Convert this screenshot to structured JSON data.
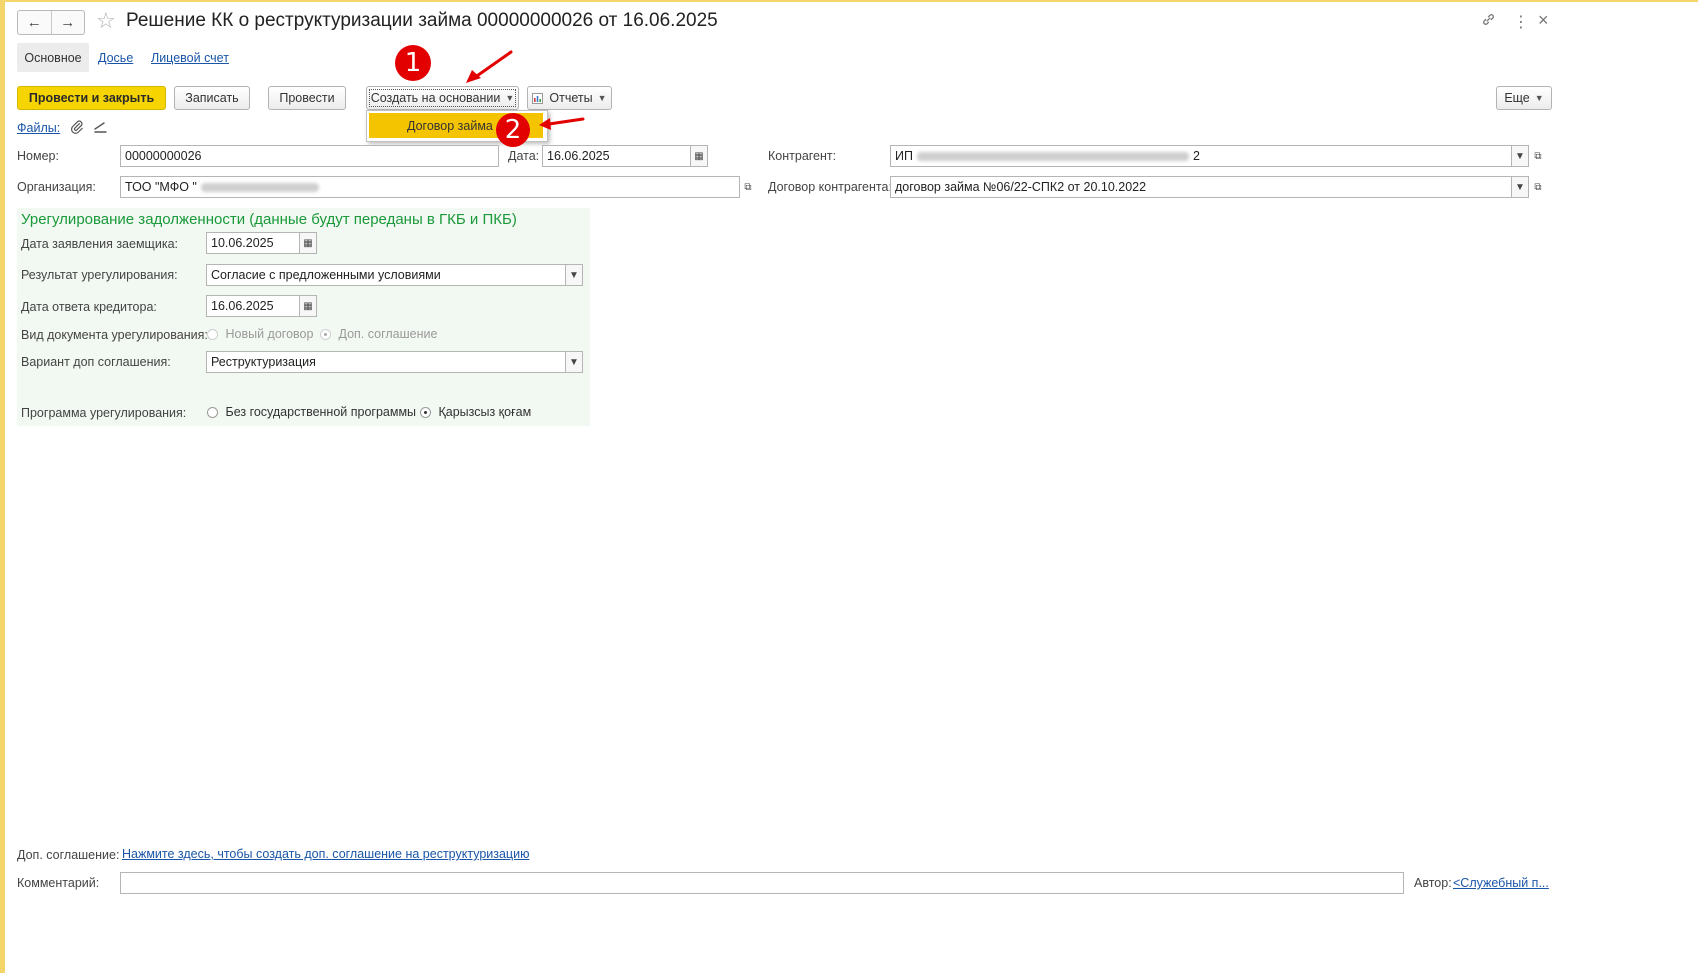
{
  "header": {
    "title": "Решение КК о реструктуризации займа 00000000026 от 16.06.2025",
    "back_icon": "←",
    "forward_icon": "→",
    "star_icon": "☆",
    "link_icon": "🔗",
    "more_icon": "⋮",
    "close_icon": "×"
  },
  "tabs": [
    {
      "label": "Основное"
    },
    {
      "label": "Досье"
    },
    {
      "label": "Лицевой счет"
    }
  ],
  "toolbar": {
    "post_close": "Провести и закрыть",
    "save": "Записать",
    "post": "Провести",
    "create_based": "Создать на основании",
    "reports": "Отчеты",
    "more": "Еще"
  },
  "create_based_menu": {
    "items": [
      "Договор займа"
    ]
  },
  "callouts": [
    "1",
    "2"
  ],
  "files": {
    "label": "Файлы:"
  },
  "form": {
    "number_label": "Номер:",
    "number_value": "00000000026",
    "date_label": "Дата:",
    "date_value": "16.06.2025",
    "org_label": "Организация:",
    "org_value_prefix": "ТОО \"МФО \"",
    "counterparty_label": "Контрагент:",
    "counterparty_prefix": "ИП",
    "counterparty_suffix": "2",
    "contract_label": "Договор контрагента:",
    "contract_value": "договор займа №06/22-СПК2 от 20.10.2022"
  },
  "settlement": {
    "title": "Урегулирование задолженности (данные будут переданы в ГКБ и ПКБ)",
    "app_date_label": "Дата заявления заемщика:",
    "app_date_value": "10.06.2025",
    "result_label": "Результат урегулирования:",
    "result_value": "Согласие с предложенными условиями",
    "reply_date_label": "Дата ответа кредитора:",
    "reply_date_value": "16.06.2025",
    "doc_kind_label": "Вид документа урегулирования:",
    "doc_kind_options": [
      "Новый договор",
      "Доп. соглашение"
    ],
    "variant_label": "Вариант доп соглашения:",
    "variant_value": "Реструктуризация",
    "program_label": "Программа урегулирования:",
    "program_options": [
      "Без государственной программы",
      "Қарызсыз қоғам"
    ]
  },
  "footer": {
    "addendum_label": "Доп. соглашение:",
    "addendum_link": "Нажмите здесь, чтобы создать доп. соглашение на реструктуризацию",
    "comment_label": "Комментарий:",
    "comment_value": "",
    "author_label": "Автор:",
    "author_link": "<Служебный п..."
  }
}
